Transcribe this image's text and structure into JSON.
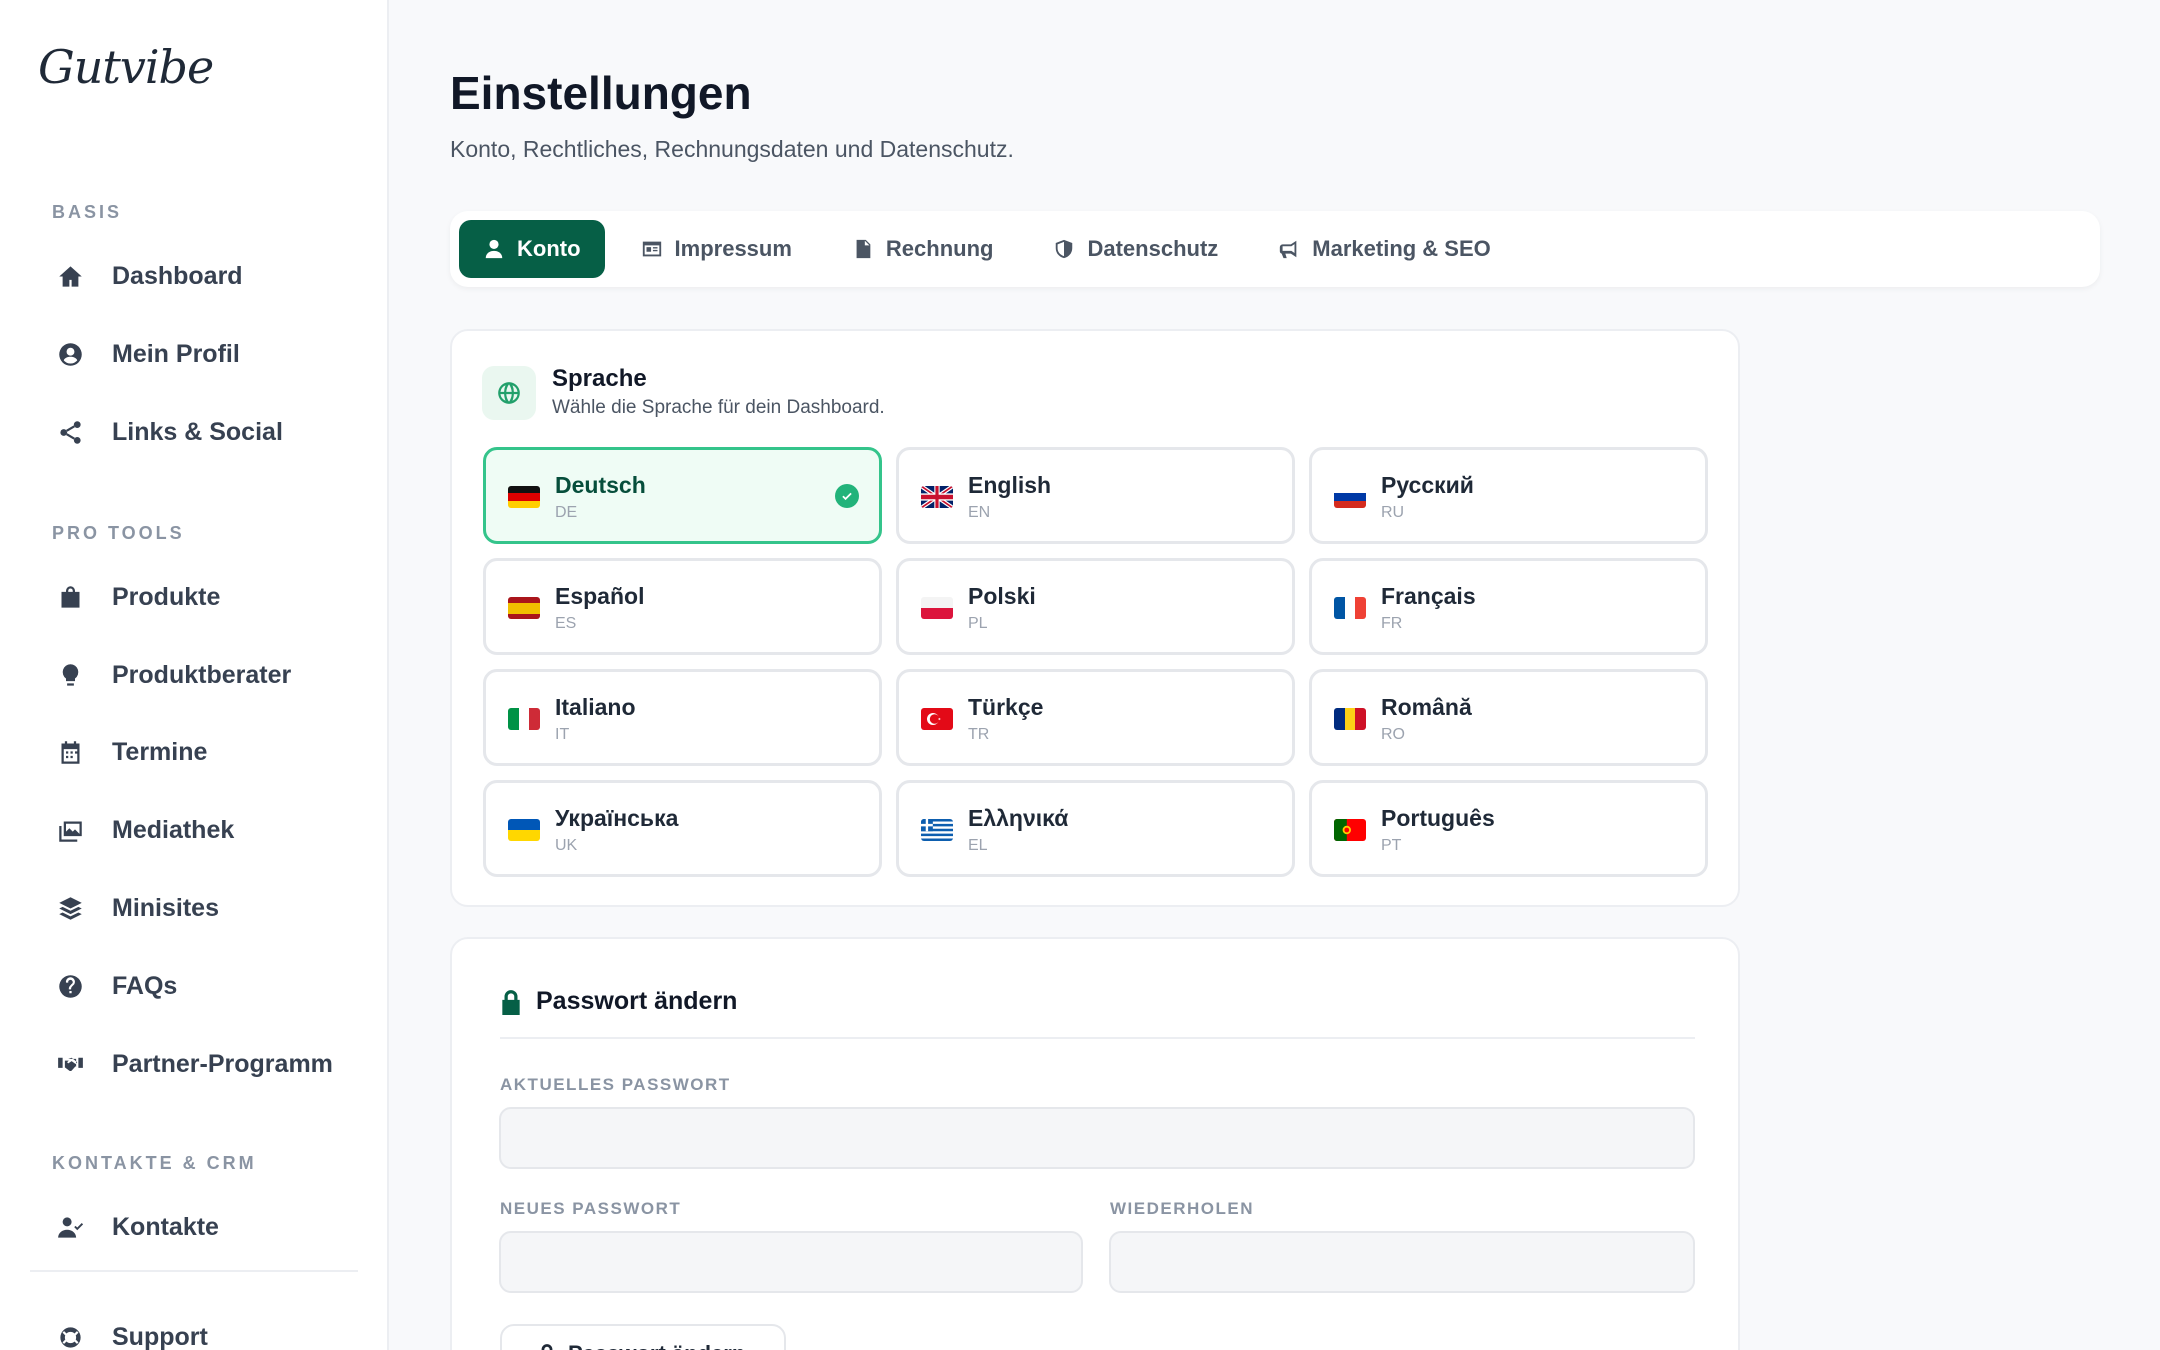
{
  "brand": {
    "logo": "Gutvibe"
  },
  "sidebar": {
    "sections": [
      {
        "label": "BASIS"
      },
      {
        "label": "PRO TOOLS"
      },
      {
        "label": "KONTAKTE & CRM"
      }
    ],
    "items": [
      {
        "label": "Dashboard",
        "icon": "home-icon"
      },
      {
        "label": "Mein Profil",
        "icon": "user-circle-icon"
      },
      {
        "label": "Links & Social",
        "icon": "share-icon"
      },
      {
        "label": "Produkte",
        "icon": "shopping-bag-icon"
      },
      {
        "label": "Produktberater",
        "icon": "lightbulb-icon"
      },
      {
        "label": "Termine",
        "icon": "calendar-icon"
      },
      {
        "label": "Mediathek",
        "icon": "images-icon"
      },
      {
        "label": "Minisites",
        "icon": "layers-icon"
      },
      {
        "label": "FAQs",
        "icon": "question-circle-icon"
      },
      {
        "label": "Partner-Programm",
        "icon": "handshake-icon"
      },
      {
        "label": "Kontakte",
        "icon": "user-check-icon"
      },
      {
        "label": "Support",
        "icon": "lifebuoy-icon"
      }
    ]
  },
  "header": {
    "title": "Einstellungen",
    "subtitle": "Konto, Rechtliches, Rechnungsdaten und Datenschutz."
  },
  "tabs": [
    {
      "label": "Konto",
      "icon": "user-icon",
      "active": true
    },
    {
      "label": "Impressum",
      "icon": "id-card-icon",
      "active": false
    },
    {
      "label": "Rechnung",
      "icon": "document-icon",
      "active": false
    },
    {
      "label": "Datenschutz",
      "icon": "shield-icon",
      "active": false
    },
    {
      "label": "Marketing & SEO",
      "icon": "megaphone-icon",
      "active": false
    }
  ],
  "language": {
    "title": "Sprache",
    "subtitle": "Wähle die Sprache für dein Dashboard.",
    "selected": "DE",
    "options": [
      {
        "name": "Deutsch",
        "code": "DE"
      },
      {
        "name": "English",
        "code": "EN"
      },
      {
        "name": "Русский",
        "code": "RU"
      },
      {
        "name": "Español",
        "code": "ES"
      },
      {
        "name": "Polski",
        "code": "PL"
      },
      {
        "name": "Français",
        "code": "FR"
      },
      {
        "name": "Italiano",
        "code": "IT"
      },
      {
        "name": "Türkçe",
        "code": "TR"
      },
      {
        "name": "Română",
        "code": "RO"
      },
      {
        "name": "Українська",
        "code": "UK"
      },
      {
        "name": "Ελληνικά",
        "code": "EL"
      },
      {
        "name": "Português",
        "code": "PT"
      }
    ]
  },
  "password": {
    "title": "Passwort ändern",
    "current_label": "AKTUELLES PASSWORT",
    "current_value": "",
    "new_label": "NEUES PASSWORT",
    "new_value": "",
    "repeat_label": "WIEDERHOLEN",
    "repeat_value": "",
    "submit_label": "Passwort ändern"
  },
  "colors": {
    "accent": "#065f46",
    "selected_border": "#34c48b",
    "selected_bg": "#effcf5"
  }
}
